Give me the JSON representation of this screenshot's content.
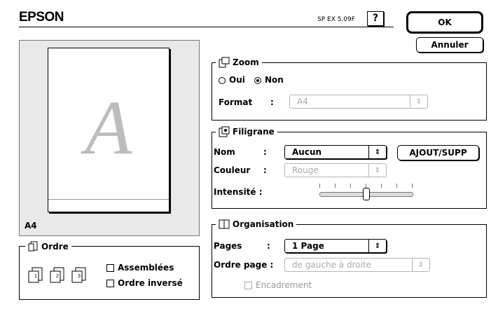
{
  "header": {
    "brand": "EPSON",
    "version": "SP EX 5.09F",
    "help_label": "?",
    "ok_label": "OK",
    "cancel_label": "Annuler"
  },
  "preview": {
    "letter": "A",
    "paper_label": "A4"
  },
  "ordre": {
    "title": "Ordre",
    "assemble_label": "Assemblées",
    "reverse_label": "Ordre inversé",
    "page_numbers": [
      "1",
      "2",
      "3"
    ]
  },
  "zoom": {
    "title": "Zoom",
    "oui_label": "Oui",
    "non_label": "Non",
    "selected": "Non",
    "format_label": "Format",
    "colon": ":",
    "format_value": "A4"
  },
  "filigrane": {
    "title": "Filigrane",
    "nom_label": "Nom",
    "colon": ":",
    "nom_value": "Aucun",
    "add_button": "AJOUT/SUPP",
    "couleur_label": "Couleur",
    "couleur_value": "Rouge",
    "intensite_label": "Intensité :",
    "intensite_level": 0.5
  },
  "organisation": {
    "title": "Organisation",
    "pages_label": "Pages",
    "colon": ":",
    "pages_value": "1 Page",
    "ordre_page_label": "Ordre page :",
    "ordre_page_value": "de gauche à droite",
    "encadrement_label": "Encadrement"
  },
  "icons": {
    "updown_arrow": "⇕"
  }
}
